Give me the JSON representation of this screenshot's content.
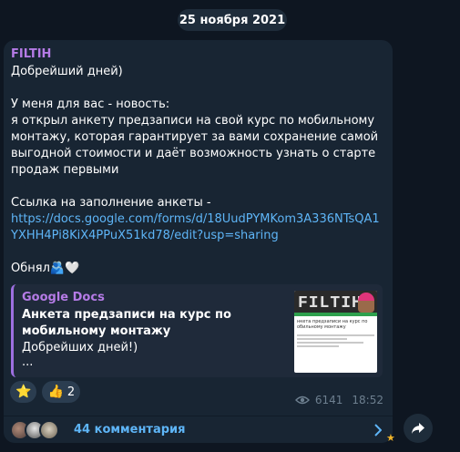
{
  "date": "25 ноября 2021",
  "message": {
    "channel": "FILTIH",
    "greeting": "Добрейший дней)",
    "paragraph": "У меня для вас - новость:\nя открыл анкету предзаписи на свой курс по мобильному монтажу, которая гарантирует за вами сохранение самой выгодной стоимости и даёт возможность узнать о старте продаж первыми",
    "link_intro": "Ссылка на заполнение анкеты -",
    "link_url": "https://docs.google.com/forms/d/18UudPYMKom3A336NTsQA1YXHH4Pi8KiX4PPuX51kd78/edit?usp=sharing",
    "sign_off": "Обнял",
    "emojis": "🫂🤍"
  },
  "preview": {
    "site": "Google Docs",
    "title": "Анкета предзаписи на курс по мобильному монтажу",
    "description": "Добрейших дней!)",
    "ellipsis": "...",
    "thumbnail_logo": "FILTIH",
    "thumbnail_caption": "нкета предзаписи на курс по обильному монтажу"
  },
  "reactions": [
    {
      "emoji": "⭐",
      "count": ""
    },
    {
      "emoji": "👍",
      "count": "2"
    }
  ],
  "views": "6141",
  "time": "18:52",
  "comments": {
    "label": "44 комментария"
  },
  "colors": {
    "background": "#0e1621",
    "bubble": "#182533",
    "channel_name": "#b57be6",
    "link": "#5eb5f7"
  }
}
